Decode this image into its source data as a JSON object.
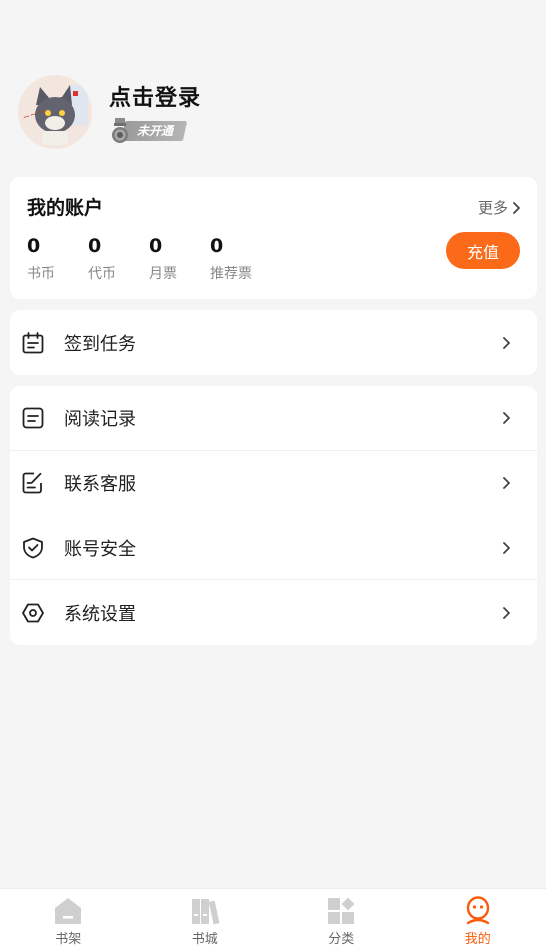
{
  "profile": {
    "login_label": "点击登录",
    "vip_status": "未开通"
  },
  "account": {
    "title": "我的账户",
    "more_label": "更多",
    "recharge_label": "充值",
    "stats": [
      {
        "value": "0",
        "label": "书币"
      },
      {
        "value": "0",
        "label": "代币"
      },
      {
        "value": "0",
        "label": "月票"
      },
      {
        "value": "0",
        "label": "推荐票"
      }
    ]
  },
  "menu": {
    "checkin": {
      "label": "签到任务",
      "icon": "calendar-icon"
    },
    "items": [
      {
        "label": "阅读记录",
        "icon": "reading-record-icon"
      },
      {
        "label": "联系客服",
        "icon": "edit-note-icon"
      },
      {
        "label": "账号安全",
        "icon": "shield-check-icon"
      },
      {
        "label": "系统设置",
        "icon": "settings-hex-icon"
      }
    ]
  },
  "tabbar": {
    "tabs": [
      {
        "label": "书架",
        "icon": "bookshelf-icon"
      },
      {
        "label": "书城",
        "icon": "bookstore-icon"
      },
      {
        "label": "分类",
        "icon": "category-icon"
      },
      {
        "label": "我的",
        "icon": "profile-face-icon",
        "active": true
      }
    ]
  },
  "colors": {
    "accent": "#fb6a18",
    "tab_active": "#fb5a0a",
    "background": "#f5f5f5"
  }
}
